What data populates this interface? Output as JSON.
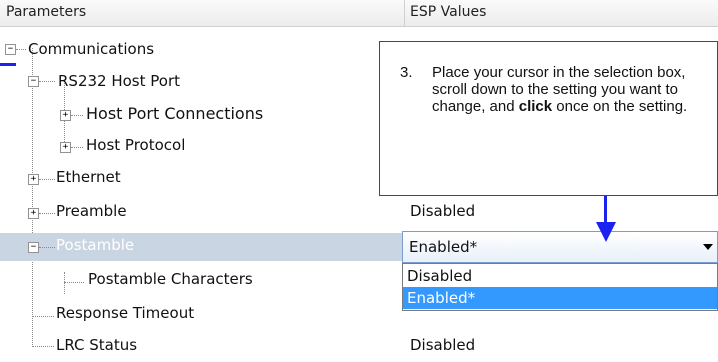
{
  "header": {
    "col_parameters": "Parameters",
    "col_values": "ESP Values"
  },
  "tree": [
    {
      "label": "Communications",
      "value": "",
      "expander": "minus"
    },
    {
      "label": "RS232 Host Port",
      "value": "",
      "expander": "minus"
    },
    {
      "label": "Host Port Connections",
      "value": "",
      "expander": "plus"
    },
    {
      "label": "Host Protocol",
      "value": "",
      "expander": "plus"
    },
    {
      "label": "Ethernet",
      "value": "",
      "expander": "plus"
    },
    {
      "label": "Preamble",
      "value": "Disabled",
      "expander": "plus"
    },
    {
      "label": "Postamble",
      "value": "",
      "expander": "minus",
      "selected": true
    },
    {
      "label": "Postamble Characters",
      "value": "",
      "expander": "none"
    },
    {
      "label": "Response Timeout",
      "value": "",
      "expander": "none"
    },
    {
      "label": "LRC Status",
      "value": "Disabled",
      "expander": "none"
    }
  ],
  "combo": {
    "selected": "Enabled*",
    "options": [
      "Disabled",
      "Enabled*"
    ],
    "highlighted_option": "Enabled*"
  },
  "callout": {
    "number": "3.",
    "text_part1": "Place your cursor in the selection box, scroll down to the setting you want to change, and ",
    "text_bold": "click",
    "text_part2": " once on the setting."
  },
  "colors": {
    "annotation_blue": "#1a22f2",
    "selection_blue": "#3399ff",
    "selected_row": "#c9d5e2"
  }
}
